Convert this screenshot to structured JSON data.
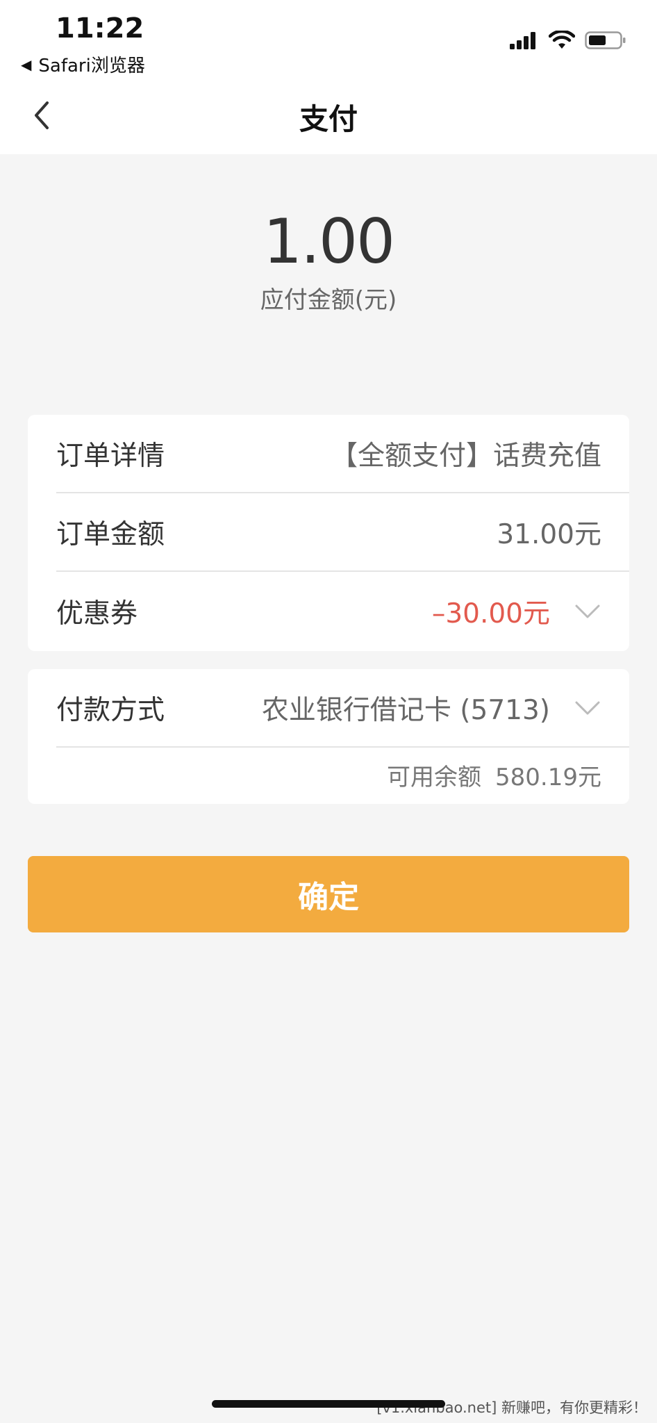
{
  "status_bar": {
    "time": "11:22",
    "back_app": "Safari浏览器",
    "icons": [
      "cellular-signal-icon",
      "wifi-icon",
      "battery-icon"
    ]
  },
  "nav": {
    "title": "支付",
    "back_icon": "chevron-left-icon"
  },
  "payment": {
    "amount": "1.00",
    "amount_label": "应付金额(元)"
  },
  "order_card": {
    "rows": [
      {
        "label": "订单详情",
        "value": "【全额支付】话费充值"
      },
      {
        "label": "订单金额",
        "value": "31.00元"
      },
      {
        "label": "优惠券",
        "value": "–30.00元"
      }
    ]
  },
  "method_card": {
    "label": "付款方式",
    "value": "农业银行借记卡 (5713)",
    "balance_label": "可用余额",
    "balance_value": "580.19元"
  },
  "confirm_label": "确定",
  "watermark": "[v1.xianbao.net] 新赚吧，有你更精彩！",
  "colors": {
    "accent": "#f3ab3f",
    "discount": "#e25a4e",
    "background": "#f5f5f5"
  }
}
